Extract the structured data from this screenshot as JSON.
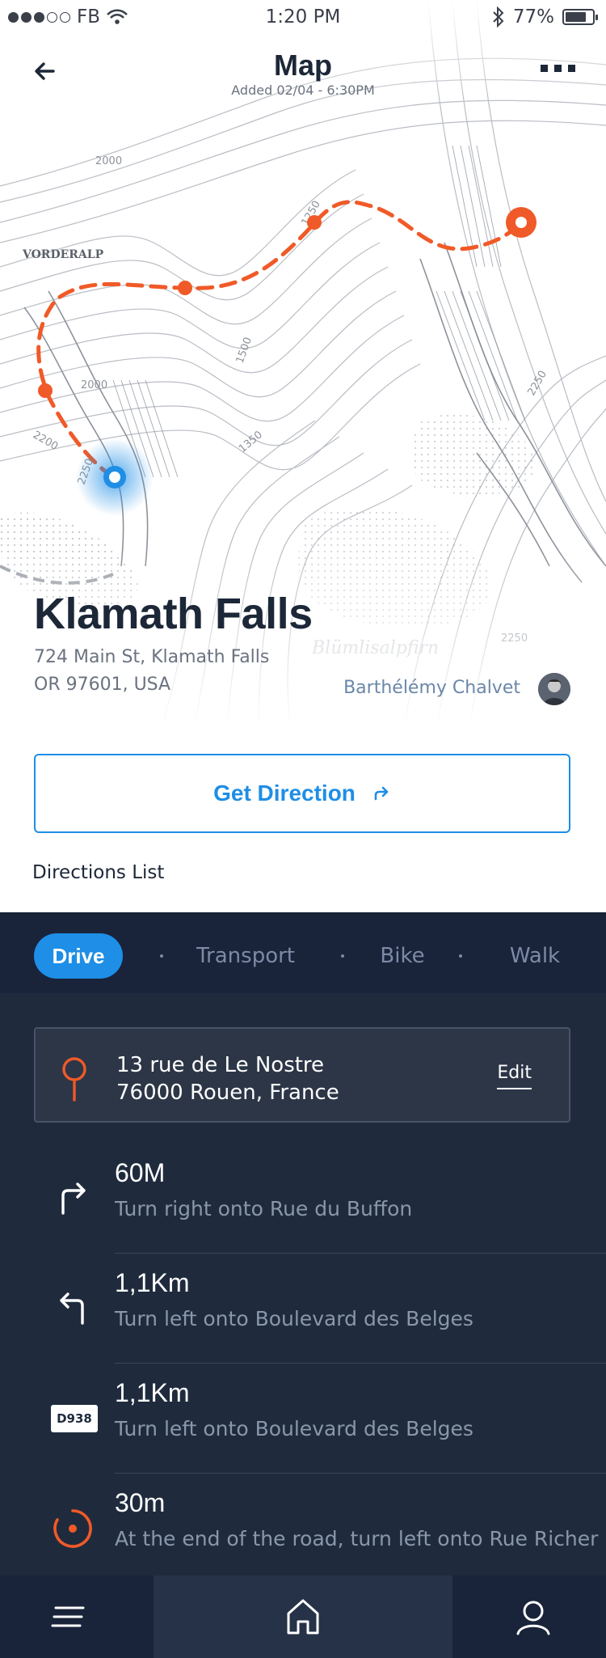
{
  "status_bar": {
    "carrier": "FB",
    "time": "1:20 PM",
    "battery": "77%"
  },
  "nav": {
    "title": "Map",
    "subtitle": "Added 02/04 - 6:30PM"
  },
  "map": {
    "labels": [
      "VORDERALP",
      "2000",
      "1250",
      "1500",
      "1350",
      "2000",
      "2200",
      "2250",
      "2250",
      "Blümlisalpfirn",
      "2250"
    ]
  },
  "place": {
    "name": "Klamath Falls",
    "address_line1": "724 Main St, Klamath Falls",
    "address_line2": "OR 97601, USA",
    "author": "Barthélémy Chalvet"
  },
  "get_direction": {
    "label": "Get Direction"
  },
  "directions_list_label": "Directions List",
  "tabs": [
    {
      "label": "Drive",
      "active": true
    },
    {
      "label": "Transport",
      "active": false
    },
    {
      "label": "Bike",
      "active": false
    },
    {
      "label": "Walk",
      "active": false
    }
  ],
  "destination": {
    "line1": "13 rue de Le Nostre",
    "line2": "76000 Rouen, France",
    "edit_label": "Edit"
  },
  "steps": [
    {
      "icon": "turn-right-icon",
      "distance": "60M",
      "instruction": "Turn right onto Rue du Buffon"
    },
    {
      "icon": "turn-left-icon",
      "distance": "1,1Km",
      "instruction": "Turn left onto Boulevard des Belges"
    },
    {
      "icon": "road-badge",
      "badge": "D938",
      "distance": "1,1Km",
      "instruction": "Turn left onto Boulevard des Belges"
    },
    {
      "icon": "roundabout-icon",
      "distance": "30m",
      "instruction": "At the end of the road, turn left onto Rue Richer"
    }
  ],
  "colors": {
    "accent_blue": "#1e8ee6",
    "route_orange": "#f05a28",
    "dark_bg": "#1f2b3d"
  }
}
